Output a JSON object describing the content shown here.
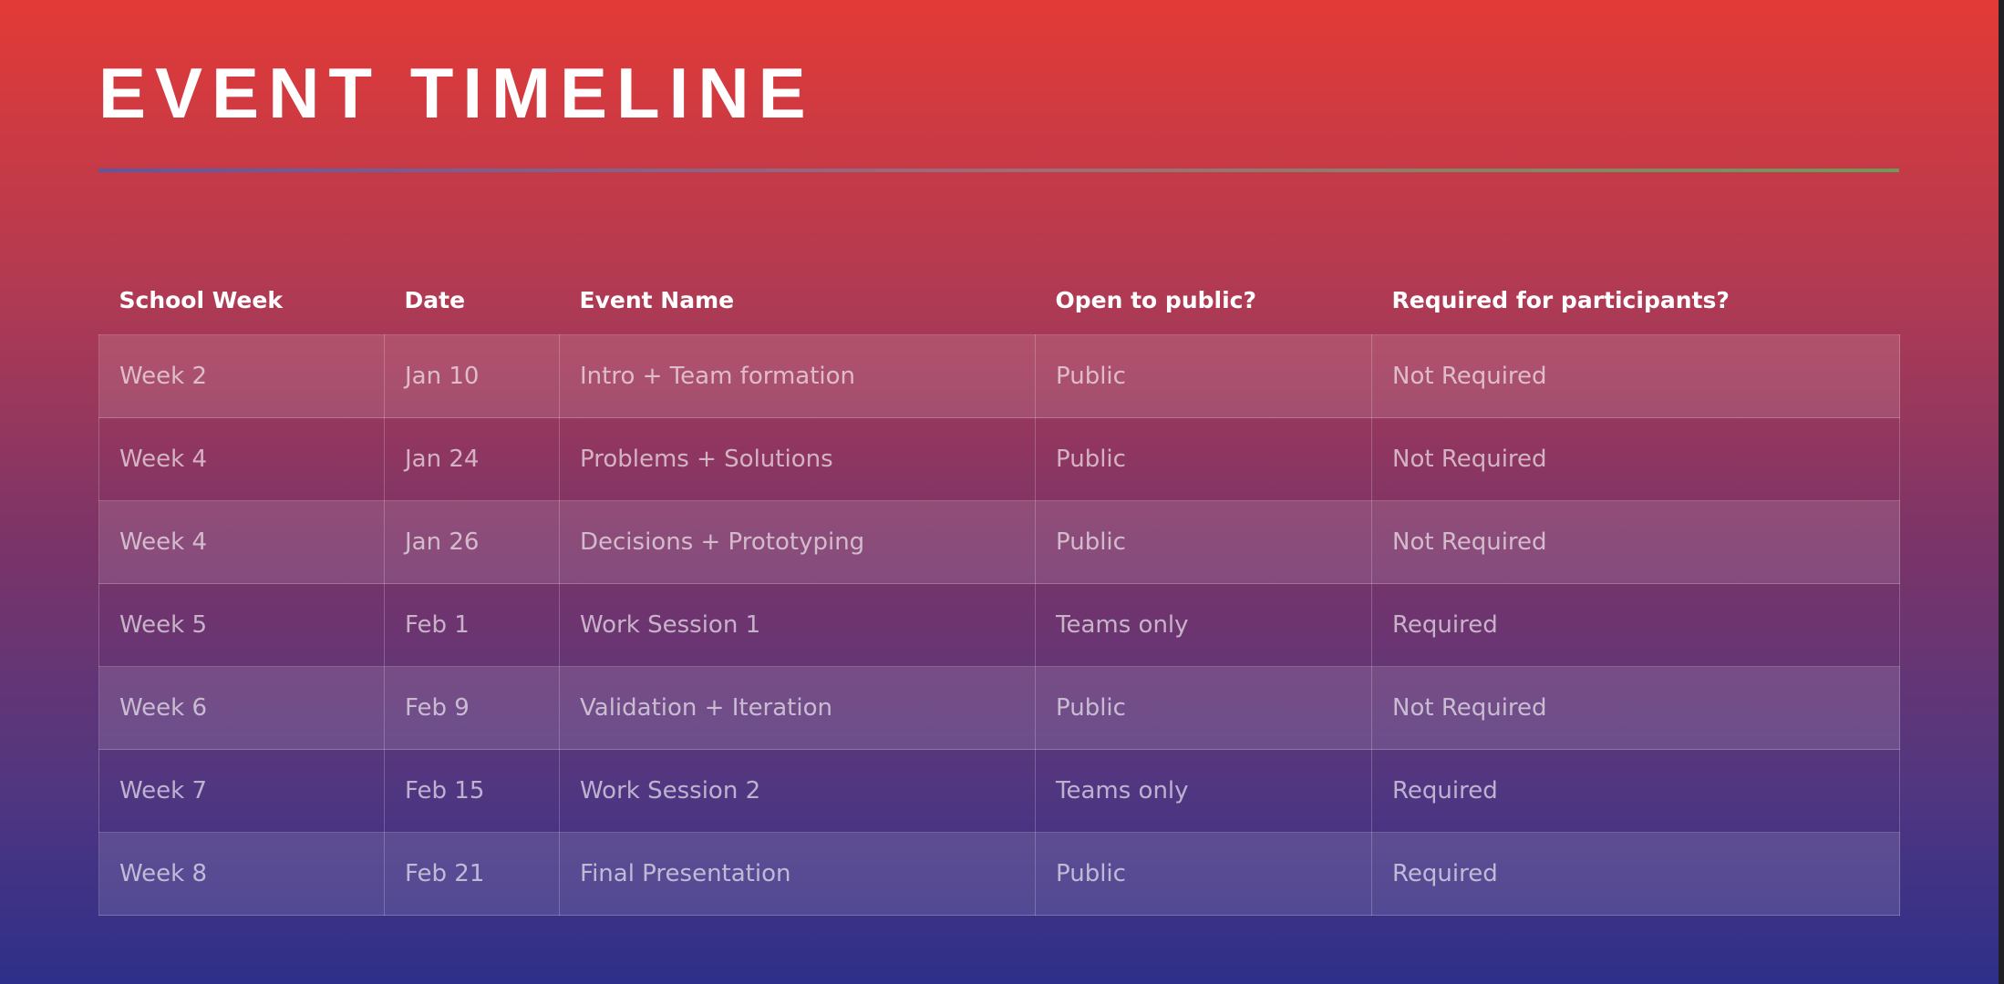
{
  "page": {
    "title": "EVENT TIMELINE"
  },
  "colors": {
    "background_top": "#e33a36",
    "background_bottom": "#2e2f8a",
    "divider_left": "#5d58a3",
    "divider_right": "#6b9b5a"
  },
  "table": {
    "headers": [
      "School Week",
      "Date",
      "Event Name",
      "Open to public?",
      "Required for participants?"
    ],
    "rows": [
      [
        "Week 2",
        "Jan 10",
        "Intro + Team formation",
        "Public",
        "Not Required"
      ],
      [
        "Week 4",
        "Jan 24",
        "Problems + Solutions",
        "Public",
        "Not Required"
      ],
      [
        "Week 4",
        "Jan 26",
        "Decisions + Prototyping",
        "Public",
        "Not Required"
      ],
      [
        "Week 5",
        "Feb 1",
        "Work Session 1",
        "Teams only",
        "Required"
      ],
      [
        "Week 6",
        "Feb 9",
        "Validation + Iteration",
        "Public",
        "Not Required"
      ],
      [
        "Week 7",
        "Feb 15",
        "Work Session 2",
        "Teams only",
        "Required"
      ],
      [
        "Week 8",
        "Feb 21",
        "Final Presentation",
        "Public",
        "Required"
      ]
    ]
  }
}
